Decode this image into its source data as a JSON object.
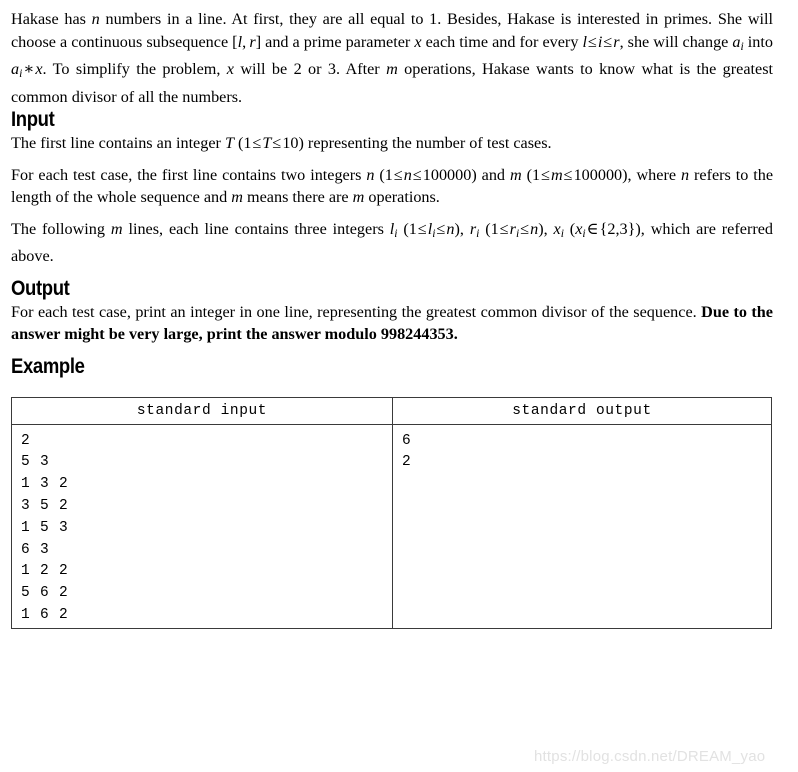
{
  "document": {
    "statement": {
      "paragraph_1": "Hakase has n numbers in a line. At first, they are all equal to 1. Besides, Hakase is interested in primes. She will choose a continuous subsequence [l, r] and a prime parameter x each time and for every l ≤ i ≤ r, she will change a_i into a_i * x. To simplify the problem, x will be 2 or 3. After m operations, Hakase wants to know what is the greatest common divisor of all the numbers."
    },
    "sections": {
      "input": {
        "heading": "Input",
        "paragraph_1": "The first line contains an integer T (1 ≤ T ≤ 10) representing the number of test cases.",
        "paragraph_2": "For each test case, the first line contains two integers n (1 ≤ n ≤ 100000) and m (1 ≤ m ≤ 100000), where n refers to the length of the whole sequence and m means there are m operations.",
        "paragraph_3": "The following m lines, each line contains three integers l_i (1 ≤ l_i ≤ n), r_i (1 ≤ r_i ≤ n), x_i (x_i ∈ {2,3}), which are referred above."
      },
      "output": {
        "heading": "Output",
        "paragraph_1_plain": "For each test case, print an integer in one line, representing the greatest common divisor of the sequence. ",
        "paragraph_1_bold": "Due to the answer might be very large, print the answer modulo 998244353."
      },
      "example": {
        "heading": "Example",
        "columns": [
          "standard input",
          "standard output"
        ],
        "standard_input_lines": [
          "2",
          "5 3",
          "1 3 2",
          "3 5 2",
          "1 5 3",
          "6 3",
          "1 2 2",
          "5 6 2",
          "1 6 2"
        ],
        "standard_output_lines": [
          "6",
          "2"
        ]
      }
    },
    "math_tokens": {
      "n": "n",
      "one": "1",
      "l": "l",
      "r": "r",
      "x": "x",
      "i": "i",
      "m": "m",
      "T": "T",
      "ten": "10",
      "limit": "100000",
      "two": "2",
      "three": "3",
      "a": "a",
      "le": "≤",
      "in": "∈",
      "times": "∗",
      "modulus": "998244353"
    },
    "watermark": "https://blog.csdn.net/DREAM_yao"
  }
}
